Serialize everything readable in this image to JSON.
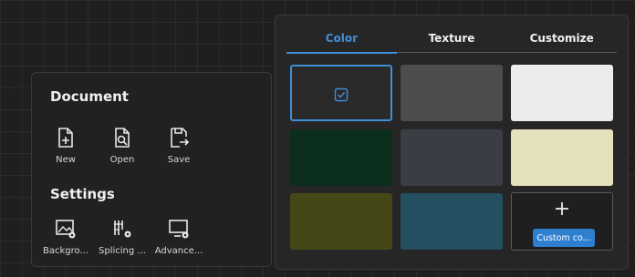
{
  "document": {
    "title": "Document",
    "tools": [
      {
        "label": "New",
        "icon": "new-file-icon"
      },
      {
        "label": "Open",
        "icon": "open-file-icon"
      },
      {
        "label": "Save",
        "icon": "save-icon"
      }
    ]
  },
  "settings": {
    "title": "Settings",
    "tools": [
      {
        "label": "Backgro...",
        "icon": "background-settings-icon"
      },
      {
        "label": "Splicing ...",
        "icon": "splicing-settings-icon"
      },
      {
        "label": "Advance...",
        "icon": "advanced-settings-icon"
      }
    ]
  },
  "tabs": [
    {
      "label": "Color",
      "active": true
    },
    {
      "label": "Texture",
      "active": false
    },
    {
      "label": "Customize",
      "active": false
    }
  ],
  "swatches": [
    {
      "color": "#2a2a2a",
      "selected": true,
      "icon": "checkbox-checked-icon"
    },
    {
      "color": "#4d4d4d"
    },
    {
      "color": "#ececec"
    },
    {
      "color": "#0c2e1d"
    },
    {
      "color": "#3a3e44"
    },
    {
      "color": "#e6e1bd"
    },
    {
      "color": "#454816"
    },
    {
      "color": "#234f60"
    }
  ],
  "custom": {
    "plus": "+",
    "label": "Custom co...",
    "accent": "#2f7fd1"
  },
  "colors": {
    "accent": "#3f8fd9"
  }
}
